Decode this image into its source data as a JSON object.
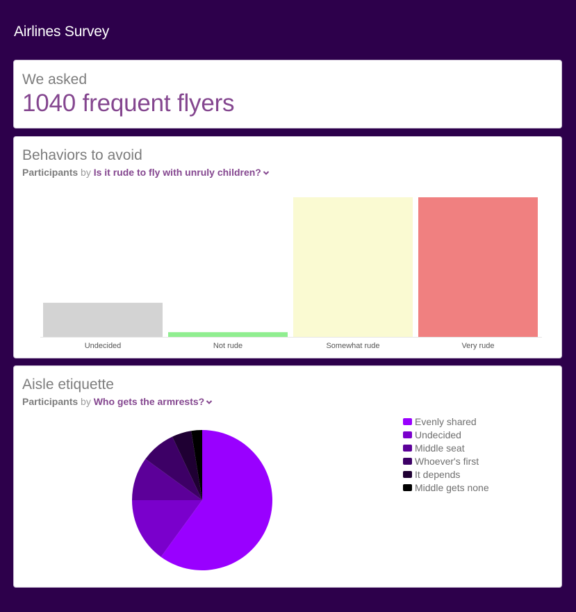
{
  "app": {
    "title": "Airlines Survey"
  },
  "summary": {
    "label": "We asked",
    "value": "1040 frequent flyers"
  },
  "behaviors": {
    "title": "Behaviors to avoid",
    "measure": "Participants",
    "by": "by",
    "dimension": "Is it rude to fly with unruly children?",
    "chart_data": {
      "type": "bar",
      "categories": [
        "Undecided",
        "Not rude",
        "Somewhat rude",
        "Very rude"
      ],
      "values": [
        101,
        14,
        413,
        413
      ],
      "colors": [
        "#d3d3d3",
        "#90ee90",
        "#fafad2",
        "#f08080"
      ],
      "ylim": [
        0,
        413
      ]
    }
  },
  "aisle": {
    "title": "Aisle etiquette",
    "measure": "Participants",
    "by": "by",
    "dimension": "Who gets the armrests?",
    "chart_data": {
      "type": "pie",
      "labels": [
        "Evenly shared",
        "Undecided",
        "Middle seat",
        "Whoever's first",
        "It depends",
        "Middle gets none"
      ],
      "values": [
        60,
        15,
        10,
        8,
        4.5,
        2.5
      ],
      "colors": [
        "#9900ff",
        "#7a00cc",
        "#5c0099",
        "#3d0066",
        "#1f0033",
        "#000000"
      ]
    }
  }
}
